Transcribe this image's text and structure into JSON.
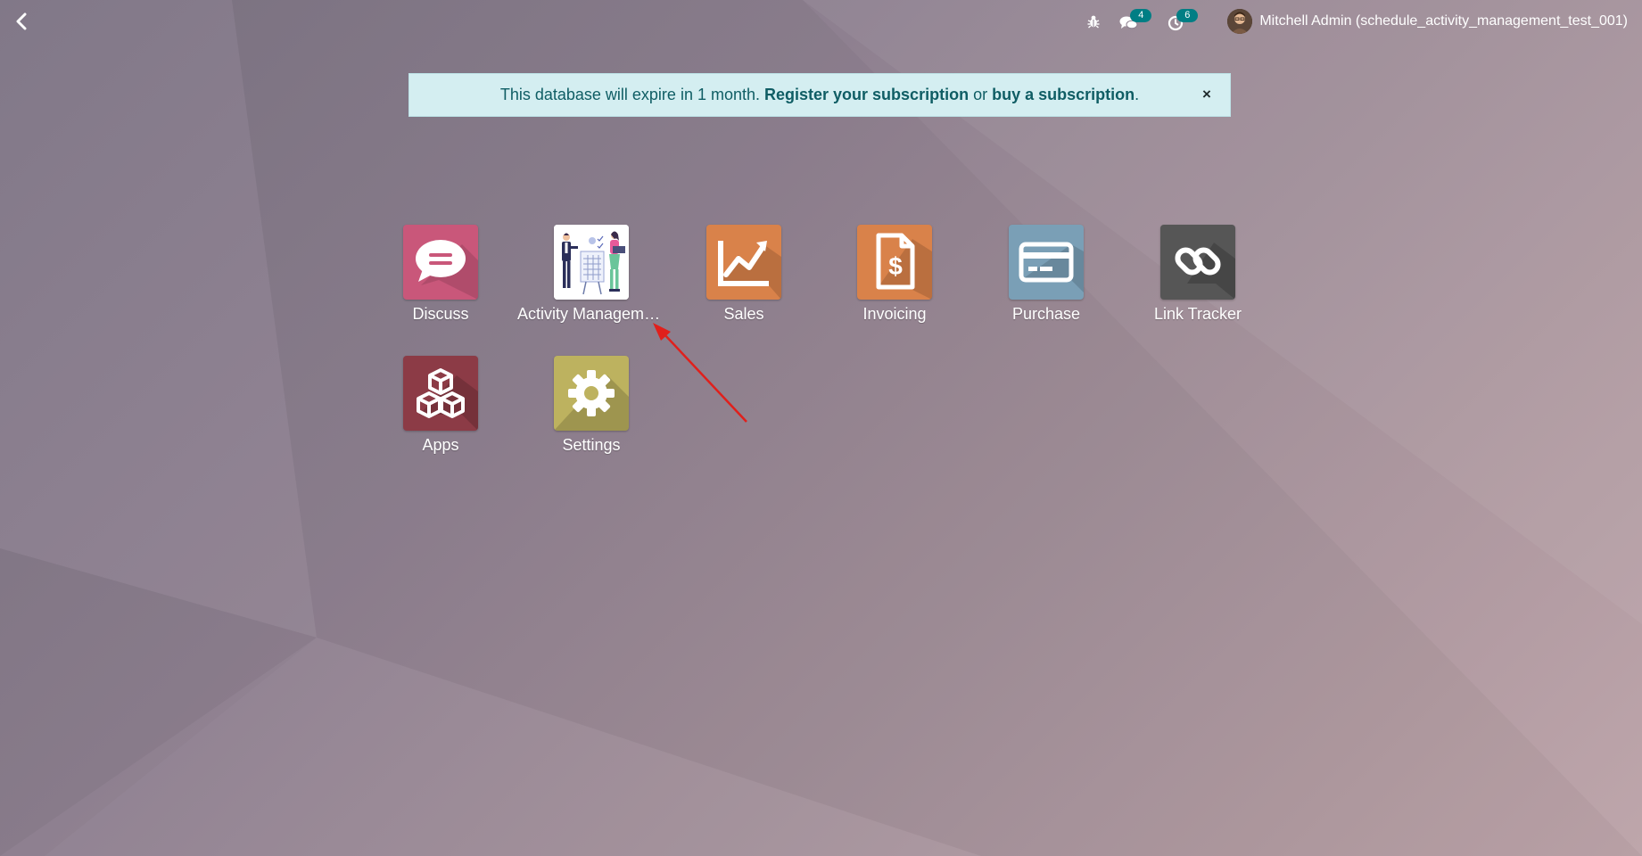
{
  "topbar": {
    "back_icon": "chevron-left-icon",
    "debug_icon": "bug-icon",
    "messages": {
      "icon": "chat-icon",
      "count": "4"
    },
    "activities": {
      "icon": "clock-icon",
      "count": "6"
    },
    "user": {
      "name": "Mitchell Admin (schedule_activity_management_test_001)"
    }
  },
  "banner": {
    "text_before": "This database will expire in 1 month.",
    "register_link": "Register your subscription",
    "text_middle": "or",
    "buy_link": "buy a subscription",
    "text_end": ".",
    "close": "×"
  },
  "apps": [
    {
      "label": "Discuss",
      "icon": "chat-bubble-icon",
      "color": "#c9577a"
    },
    {
      "label": "Activity Management",
      "icon": "activity-illustration-icon",
      "color": "#ffffff"
    },
    {
      "label": "Sales",
      "icon": "trend-chart-icon",
      "color": "#d9824a"
    },
    {
      "label": "Invoicing",
      "icon": "invoice-dollar-icon",
      "color": "#d9824a"
    },
    {
      "label": "Purchase",
      "icon": "credit-card-icon",
      "color": "#7a9fb6"
    },
    {
      "label": "Link Tracker",
      "icon": "link-icon",
      "color": "#565656"
    },
    {
      "label": "Apps",
      "icon": "cubes-icon",
      "color": "#8c3b46"
    },
    {
      "label": "Settings",
      "icon": "gear-icon",
      "color": "#bdb25f"
    }
  ],
  "colors": {
    "badge": "#017e84",
    "banner_bg": "#d4eef1",
    "banner_text": "#0f5d64",
    "annotation_arrow": "#e0201c"
  }
}
